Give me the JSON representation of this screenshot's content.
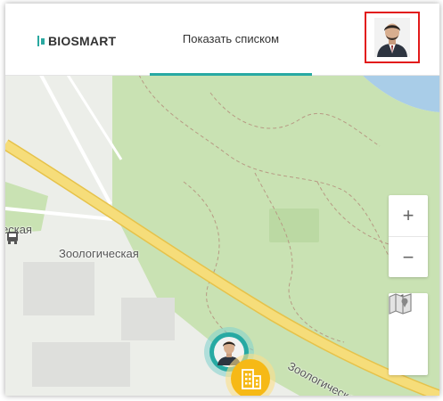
{
  "header": {
    "logo_text": "BIOSMART",
    "tab_label": "Показать списком"
  },
  "map": {
    "labels": {
      "station_partial": "ecкая",
      "station": "Зоологическая",
      "street": "Зоологическая"
    },
    "zoom_in": "+",
    "zoom_out": "−"
  },
  "colors": {
    "accent": "#27a9a3",
    "highlight_border": "#e21b1b",
    "building_pin": "#f6b916",
    "park": "#c9e2b3",
    "water": "#a9cde8"
  },
  "icons": {
    "avatar": "user-avatar-icon",
    "bus": "bus-stop-icon",
    "locate": "navigation-arrow-icon",
    "layers": "map-layers-icon",
    "building": "building-icon"
  }
}
